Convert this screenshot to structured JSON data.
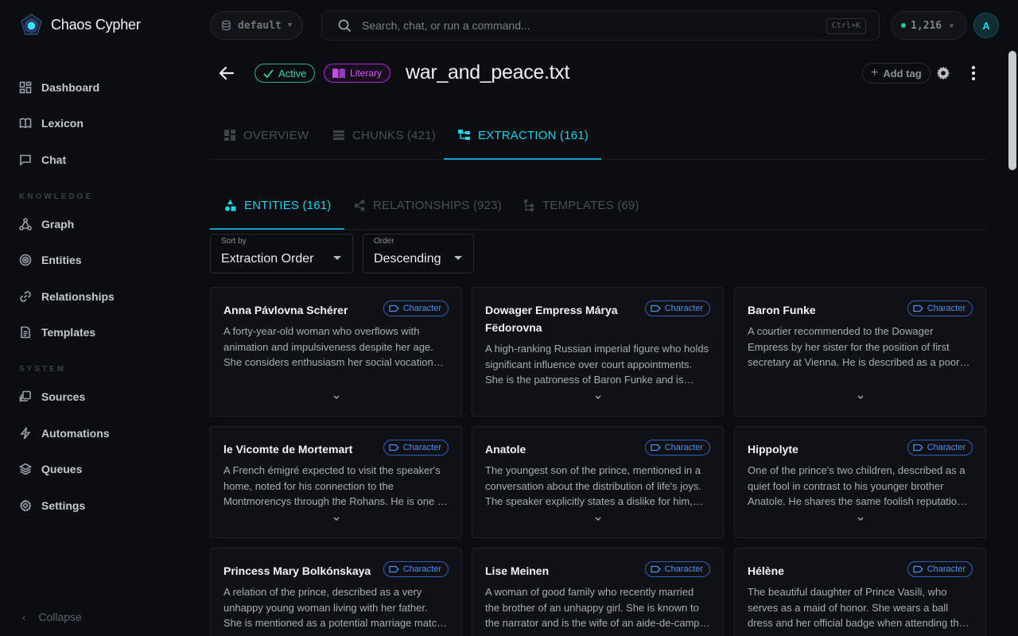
{
  "brand": {
    "name": "Chaos Cypher"
  },
  "sidebar": {
    "items": [
      {
        "label": "Dashboard",
        "icon": "grid-icon"
      },
      {
        "label": "Lexicon",
        "icon": "book-icon"
      },
      {
        "label": "Chat",
        "icon": "chat-icon"
      }
    ],
    "knowledge_label": "KNOWLEDGE",
    "knowledge_items": [
      {
        "label": "Graph",
        "icon": "graph-icon"
      },
      {
        "label": "Entities",
        "icon": "target-icon"
      },
      {
        "label": "Relationships",
        "icon": "link-icon"
      },
      {
        "label": "Templates",
        "icon": "document-icon"
      }
    ],
    "system_label": "SYSTEM",
    "system_items": [
      {
        "label": "Sources",
        "icon": "sources-icon"
      },
      {
        "label": "Automations",
        "icon": "bolt-icon"
      },
      {
        "label": "Queues",
        "icon": "layers-icon"
      },
      {
        "label": "Settings",
        "icon": "gear-icon"
      }
    ],
    "collapse_label": "Collapse"
  },
  "topbar": {
    "workspace": "default",
    "search_placeholder": "Search, chat, or run a command...",
    "shortcut": "Ctrl+K",
    "credits": "1,216",
    "avatar_initial": "A"
  },
  "header": {
    "status_badge": "Active",
    "genre_badge": "Literary",
    "title": "war_and_peace.txt",
    "add_tag": "Add tag"
  },
  "tabs": [
    {
      "label": "OVERVIEW"
    },
    {
      "label": "CHUNKS (421)"
    },
    {
      "label": "EXTRACTION (161)"
    }
  ],
  "subtabs": [
    {
      "label": "ENTITIES (161)"
    },
    {
      "label": "RELATIONSHIPS (923)"
    },
    {
      "label": "TEMPLATES (69)"
    }
  ],
  "sort": {
    "label": "Sort by",
    "value": "Extraction Order"
  },
  "order": {
    "label": "Order",
    "value": "Descending"
  },
  "entities": [
    {
      "name": "Anna Pávlovna Schérer",
      "type": "Character",
      "desc": "A forty-year-old woman who overflows with animation and impulsiveness despite her age. She considers enthusiasm her social vocation and often becomes enthusiastic even when she does not feel like it."
    },
    {
      "name": "Dowager Empress Márya Fëdorovna",
      "type": "Character",
      "desc": "A high-ranking Russian imperial figure who holds significant influence over court appointments. She is the patroness of Baron Funke and is known for her charitable institutions."
    },
    {
      "name": "Baron Funke",
      "type": "Character",
      "desc": "A courtier recommended to the Dowager Empress by her sister for the position of first secretary at Vienna. He is described as a poor creature by those who oppose his appointment."
    },
    {
      "name": "le Vicomte de Mortemart",
      "type": "Character",
      "desc": "A French émigré expected to visit the speaker's home, noted for his connection to the Montmorencys through the Rohans. He is one of the best French families."
    },
    {
      "name": "Anatole",
      "type": "Character",
      "desc": "The youngest son of the prince, mentioned in a conversation about the distribution of life's joys. The speaker explicitly states a dislike for him, calling him a troublesome fool."
    },
    {
      "name": "Hippolyte",
      "type": "Character",
      "desc": "One of the prince's two children, described as a quiet fool in contrast to his younger brother Anatole. He shares the same foolish reputation as his brother in society."
    },
    {
      "name": "Princess Mary Bolkónskaya",
      "type": "Character",
      "desc": "A relation of the prince, described as a very unhappy young woman living with her father. She is mentioned as a potential marriage match for Anatole Kuragin."
    },
    {
      "name": "Lise Meinen",
      "type": "Character",
      "desc": "A woman of good family who recently married the brother of an unhappy girl. She is known to the narrator and is the wife of an aide-de-camp to Kutúzov."
    },
    {
      "name": "Hélène",
      "type": "Character",
      "desc": "The beautiful daughter of Prince Vasíli, who serves as a maid of honor. She wears a ball dress and her official badge when attending the soirée at Anna Pávlovna's."
    }
  ]
}
